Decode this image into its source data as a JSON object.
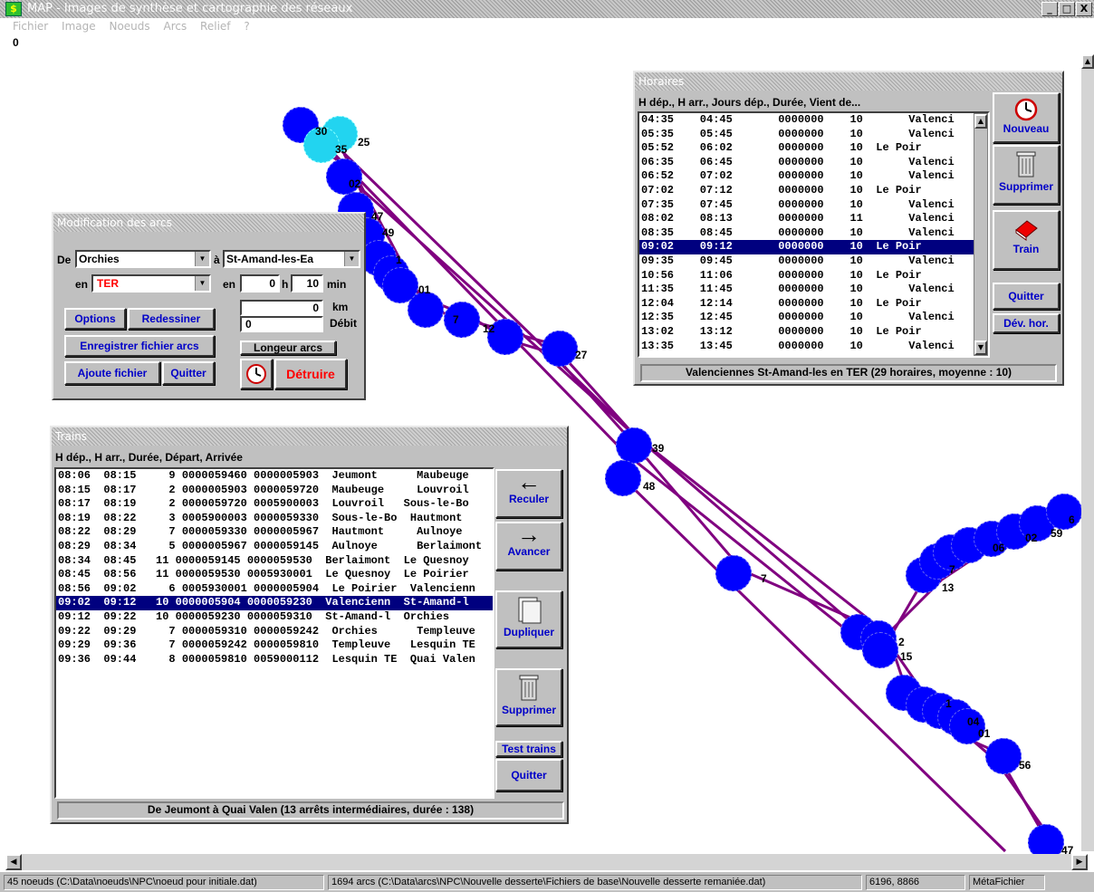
{
  "window": {
    "title": "MAP - Images de synthèse et cartographie des réseaux",
    "minimize": "_",
    "restore": "□",
    "close": "X"
  },
  "menu": [
    "Fichier",
    "Image",
    "Noeuds",
    "Arcs",
    "Relief",
    "?"
  ],
  "canvas_corner_value": "0",
  "map": {
    "line_color": "#800080",
    "node_color": "#0000ff",
    "highlight_node_color": "#22d4f0",
    "node_labels": [
      "30",
      "35",
      "25",
      "02",
      "47",
      "49",
      "1",
      "01",
      "7",
      "12",
      "27",
      "39",
      "48",
      "7",
      "2",
      "15",
      "13",
      "7",
      "06",
      "02",
      "59",
      "6",
      "1",
      "04",
      "01",
      "56",
      "47"
    ]
  },
  "arcs_panel": {
    "title": "Modification des arcs",
    "de_label": "De",
    "from_station": "Orchies",
    "a_label": "à",
    "to_station": "St-Amand-les-Ea",
    "en_label": "en",
    "mode": "TER",
    "mode_color": "#ff0000",
    "time_en_label": "en",
    "hours": "0",
    "h_label": "h",
    "minutes": "10",
    "min_label": "min",
    "km_value": "0",
    "km_label": "km",
    "debit_value": "0",
    "debit_label": "Débit",
    "buttons": {
      "options": "Options",
      "redraw": "Redessiner",
      "save_arcs": "Enregistrer fichier arcs",
      "lengths": "Longeur arcs",
      "add_file": "Ajoute fichier",
      "quit": "Quitter",
      "destroy": "Détruire"
    }
  },
  "horaires_panel": {
    "title": "Horaires",
    "header": "H dép., H arr., Jours dép., Durée, Vient de...",
    "rows": [
      "04:35    04:45       0000000    10       Valenci",
      "05:35    05:45       0000000    10       Valenci",
      "05:52    06:02       0000000    10  Le Poir",
      "06:35    06:45       0000000    10       Valenci",
      "06:52    07:02       0000000    10       Valenci",
      "07:02    07:12       0000000    10  Le Poir",
      "07:35    07:45       0000000    10       Valenci",
      "08:02    08:13       0000000    11       Valenci",
      "08:35    08:45       0000000    10       Valenci",
      "09:02    09:12       0000000    10  Le Poir",
      "09:35    09:45       0000000    10       Valenci",
      "10:56    11:06       0000000    10  Le Poir",
      "11:35    11:45       0000000    10       Valenci",
      "12:04    12:14       0000000    10  Le Poir",
      "12:35    12:45       0000000    10       Valenci",
      "13:02    13:12       0000000    10  Le Poir",
      "13:35    13:45       0000000    10       Valenci"
    ],
    "selected_index": 9,
    "status": "Valenciennes  St-Amand-les en TER  (29 horaires, moyenne : 10)",
    "buttons": {
      "new": "Nouveau",
      "delete": "Supprimer",
      "train": "Train",
      "quit": "Quitter",
      "dev": "Dév. hor."
    }
  },
  "trains_panel": {
    "title": "Trains",
    "header": "H dép., H arr., Durée, Départ, Arrivée",
    "rows": [
      "08:06  08:15     9 0000059460 0000005903  Jeumont      Maubeuge",
      "08:15  08:17     2 0000005903 0000059720  Maubeuge     Louvroil",
      "08:17  08:19     2 0000059720 0005900003  Louvroil   Sous-le-Bo",
      "08:19  08:22     3 0005900003 0000059330  Sous-le-Bo  Hautmont",
      "08:22  08:29     7 0000059330 0000005967  Hautmont     Aulnoye",
      "08:29  08:34     5 0000005967 0000059145  Aulnoye      Berlaimont",
      "08:34  08:45   11 0000059145 0000059530  Berlaimont  Le Quesnoy",
      "08:45  08:56   11 0000059530 0005930001  Le Quesnoy  Le Poirier",
      "08:56  09:02     6 0005930001 0000005904  Le Poirier  Valencienn",
      "09:02  09:12   10 0000005904 0000059230  Valencienn  St-Amand-l",
      "09:12  09:22   10 0000059230 0000059310  St-Amand-l  Orchies",
      "09:22  09:29     7 0000059310 0000059242  Orchies      Templeuve",
      "09:29  09:36     7 0000059242 0000059810  Templeuve   Lesquin TE",
      "09:36  09:44     8 0000059810 0059000112  Lesquin TE  Quai Valen"
    ],
    "selected_index": 9,
    "status": "De Jeumont       à Quai Valen (13 arrêts intermédiaires, durée : 138)",
    "buttons": {
      "back": "Reculer",
      "forward": "Avancer",
      "duplicate": "Dupliquer",
      "delete": "Supprimer",
      "test": "Test trains",
      "quit": "Quitter"
    }
  },
  "statusbar": {
    "nodes": "45 noeuds (C:\\Data\\noeuds\\NPC\\noeud pour initiale.dat)",
    "arcs": "1694 arcs (C:\\Data\\arcs\\NPC\\Nouvelle desserte\\Fichiers de base\\Nouvelle desserte remaniée.dat)",
    "coords": "6196, 8866",
    "format": "MétaFichier"
  }
}
